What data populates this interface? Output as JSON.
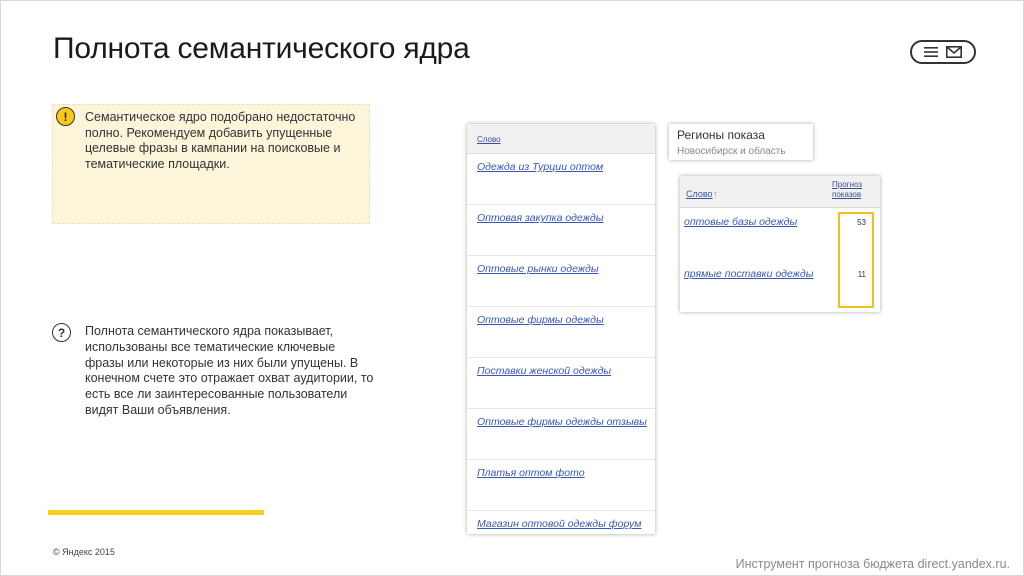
{
  "slide": {
    "title": "Полнота семантического ядра",
    "note": "Семантическое ядро подобрано недостаточно полно. Рекомендуем добавить упущенные целевые фразы в кампании на поисковые и тематические площадки.",
    "warn_symbol": "!",
    "help_symbol": "?",
    "help_text": "Полнота семантического ядра показывает, использованы все тематические ключевые фразы или некоторые из них были упущены. В конечном счете это отражает охват аудитории, то есть все ли заинтересованные пользователи видят Ваши объявления.",
    "copyright": "© Яндекс 2015",
    "footer": "Инструмент прогноза бюджета direct.yandex.ru.",
    "accent_color": "#f8cf1c"
  },
  "keywords_table": {
    "header": "Слово",
    "rows": [
      "Одежда из Турции оптом",
      "Оптовая закупка одежды",
      "Оптовые рынки одежды",
      "Оптовые фирмы одежды",
      "Поставки женской одежды",
      "Оптовые фирмы одежды отзывы",
      "Платья оптом фото",
      "Магазин оптовой одежды форум"
    ]
  },
  "regions": {
    "title": "Регионы показа",
    "value": "Новосибирск и область"
  },
  "forecast_table": {
    "col_word": "Слово",
    "sort_arrow": "↑",
    "col_forecast": "Прогноз показов",
    "rows": [
      {
        "phrase": "оптовые базы одежды",
        "value": "53"
      },
      {
        "phrase": "прямые поставки одежды",
        "value": "11"
      }
    ]
  }
}
